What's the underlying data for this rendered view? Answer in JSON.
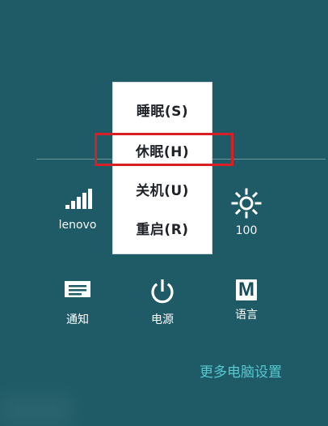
{
  "colors": {
    "background": "#1e5b66",
    "menu_background": "#ffffff",
    "highlight": "#d81f26",
    "link": "#56c8d0"
  },
  "power_menu": {
    "items": [
      {
        "label": "睡眠(S)"
      },
      {
        "label": "休眠(H)"
      },
      {
        "label": "关机(U)"
      },
      {
        "label": "重启(R)"
      }
    ]
  },
  "status": {
    "network": {
      "label": "lenovo",
      "icon": "signal-bars-icon"
    },
    "brightness": {
      "label": "100",
      "icon": "sun-icon"
    }
  },
  "bottom_tiles": {
    "notifications": {
      "label": "通知",
      "icon": "keyboard-icon"
    },
    "power": {
      "label": "电源",
      "icon": "power-icon"
    },
    "language": {
      "label": "语言",
      "icon": "m-icon",
      "icon_text": "M"
    }
  },
  "more_settings": {
    "label": "更多电脑设置"
  }
}
